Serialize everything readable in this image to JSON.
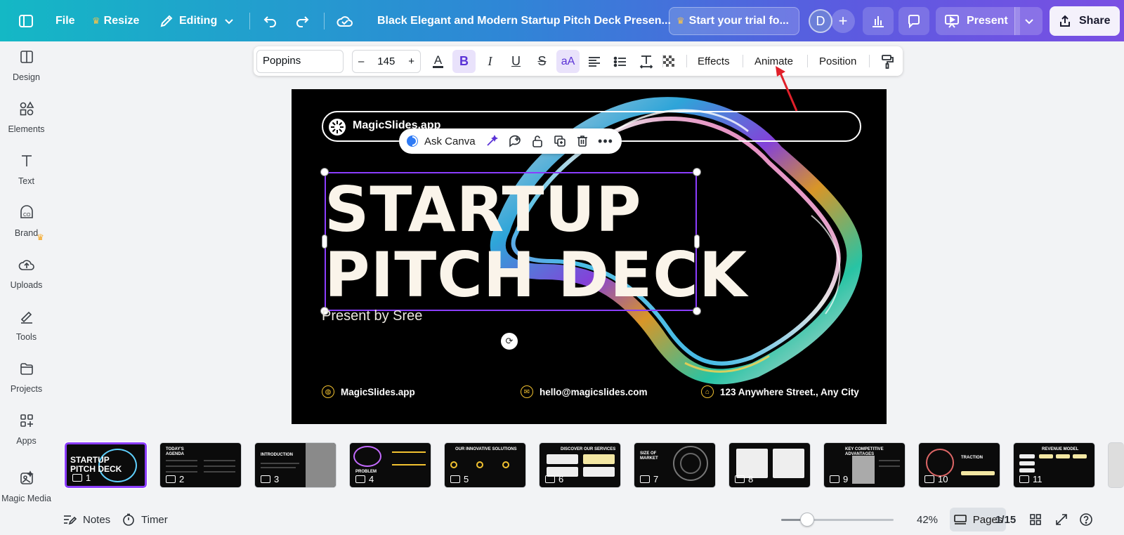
{
  "topbar": {
    "file": "File",
    "resize": "Resize",
    "editing": "Editing",
    "doc_title": "Black Elegant and Modern Startup Pitch Deck Presen...",
    "trial": "Start your trial fo...",
    "avatar_initial": "D",
    "present": "Present",
    "share": "Share"
  },
  "sidebar": {
    "items": [
      {
        "label": "Design",
        "icon": "design-icon"
      },
      {
        "label": "Elements",
        "icon": "elements-icon"
      },
      {
        "label": "Text",
        "icon": "text-icon"
      },
      {
        "label": "Brand",
        "icon": "brand-icon"
      },
      {
        "label": "Uploads",
        "icon": "uploads-icon"
      },
      {
        "label": "Tools",
        "icon": "tools-icon"
      },
      {
        "label": "Projects",
        "icon": "projects-icon"
      },
      {
        "label": "Apps",
        "icon": "apps-icon"
      },
      {
        "label": "Magic Media",
        "icon": "magic-media-icon"
      }
    ]
  },
  "text_toolbar": {
    "font": "Poppins",
    "minus": "–",
    "font_size": "145",
    "plus": "+",
    "effects": "Effects",
    "animate": "Animate",
    "position": "Position"
  },
  "slide": {
    "brand": "MagicSlides.app",
    "headline_line1": "STARTUP",
    "headline_line2": "PITCH DECK",
    "subline": "Present by Sree",
    "footer_site": "MagicSlides.app",
    "footer_email": "hello@magicslides.com",
    "footer_address": "123 Anywhere Street., Any City"
  },
  "ask_bar": {
    "label": "Ask Canva"
  },
  "thumbnails": [
    {
      "num": "1",
      "title": "STARTUP PITCH DECK"
    },
    {
      "num": "2",
      "title": "TODAY'S AGENDA"
    },
    {
      "num": "3",
      "title": "INTRODUCTION"
    },
    {
      "num": "4",
      "title": "PROBLEM"
    },
    {
      "num": "5",
      "title": "OUR INNOVATIVE SOLUTIONS"
    },
    {
      "num": "6",
      "title": "DISCOVER OUR SERVICES"
    },
    {
      "num": "7",
      "title": "SIZE OF MARKET"
    },
    {
      "num": "8",
      "title": ""
    },
    {
      "num": "9",
      "title": "KEY COMPETITIVE ADVANTAGES"
    },
    {
      "num": "10",
      "title": "TRACTION"
    },
    {
      "num": "11",
      "title": "REVENUE MODEL"
    }
  ],
  "bottombar": {
    "notes": "Notes",
    "timer": "Timer",
    "zoom": "42%",
    "zoom_value": 0.42,
    "pages": "Pages",
    "page_count": "1/15"
  },
  "colors": {
    "accent": "#8b3dff",
    "footer_icon": "#f2c230",
    "headline": "#faf4ea"
  }
}
